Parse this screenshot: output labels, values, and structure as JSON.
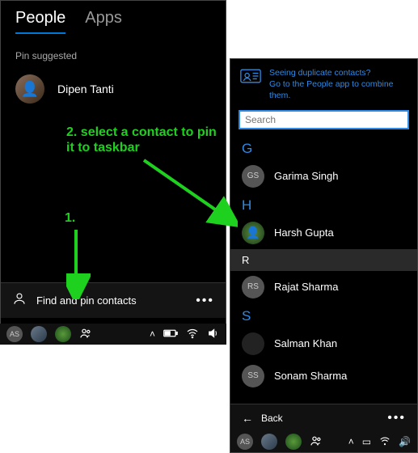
{
  "tabs": {
    "people": "People",
    "apps": "Apps"
  },
  "pin_suggested_label": "Pin suggested",
  "suggested_contact": {
    "name": "Dipen Tanti"
  },
  "find_row": {
    "label": "Find and pin contacts"
  },
  "taskbar_left": {
    "badge": "AS"
  },
  "notice": {
    "line1": "Seeing duplicate contacts?",
    "line2": "Go to the People app to combine them."
  },
  "search": {
    "placeholder": "Search"
  },
  "sections": {
    "g": {
      "letter": "G",
      "items": [
        {
          "initials": "GS",
          "name": "Garima Singh"
        }
      ]
    },
    "h": {
      "letter": "H",
      "items": [
        {
          "initials": "",
          "name": "Harsh Gupta",
          "photo": true
        }
      ]
    },
    "r": {
      "letter": "R",
      "items": [
        {
          "initials": "RS",
          "name": "Rajat Sharma"
        }
      ]
    },
    "s": {
      "letter": "S",
      "items": [
        {
          "initials": "",
          "name": "Salman Khan",
          "dark": true
        },
        {
          "initials": "SS",
          "name": "Sonam Sharma"
        }
      ]
    }
  },
  "back_label": "Back",
  "taskbar_right": {
    "badge": "AS"
  },
  "annotations": {
    "step1": "1.",
    "step2": "2. select a contact to pin it to taskbar"
  },
  "colors": {
    "accent": "#0078d7",
    "link": "#2e8ae6",
    "annotation": "#1fd11f"
  }
}
